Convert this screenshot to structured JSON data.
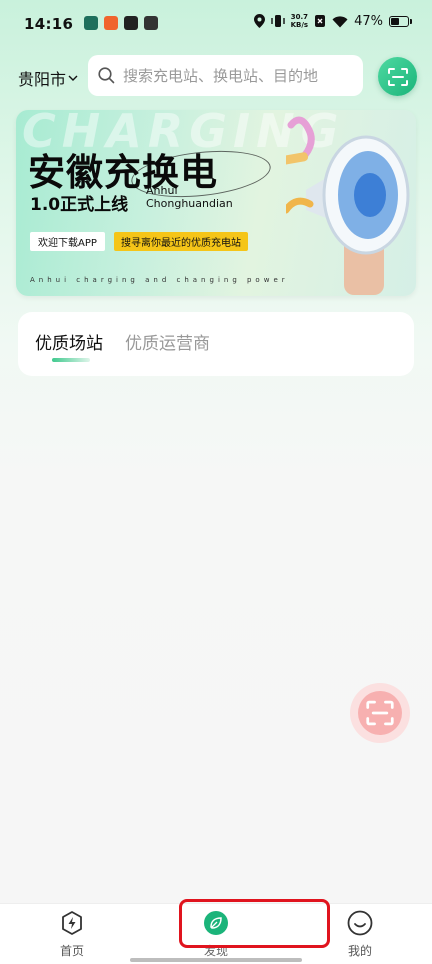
{
  "status_bar": {
    "time": "14:16",
    "net_speed_value": "30.7",
    "net_speed_unit": "KB/s",
    "battery_percent": "47%",
    "battery_level": 0.47
  },
  "header": {
    "city": "贵阳市",
    "search_placeholder": "搜索充电站、换电站、目的地"
  },
  "banner": {
    "watermark": "CHARGING",
    "title": "安徽充换电",
    "subtitle": "1.0正式上线",
    "en_line1": "Anhui",
    "en_line2": "Chonghuandian",
    "download_label": "欢迎下载APP",
    "find_label": "搜寻离你最近的优质充电站",
    "tagline": "Anhui charging and changing power"
  },
  "tabs": [
    {
      "label": "优质场站",
      "active": true
    },
    {
      "label": "优质运营商",
      "active": false
    }
  ],
  "bottom_nav": [
    {
      "label": "首页",
      "icon": "lightning-icon"
    },
    {
      "label": "发现",
      "icon": "leaf-icon"
    },
    {
      "label": "我的",
      "icon": "smile-icon"
    }
  ],
  "colors": {
    "brand_green": "#1bb47a",
    "highlight_red": "#e0141e",
    "accent_yellow": "#f5c518"
  }
}
